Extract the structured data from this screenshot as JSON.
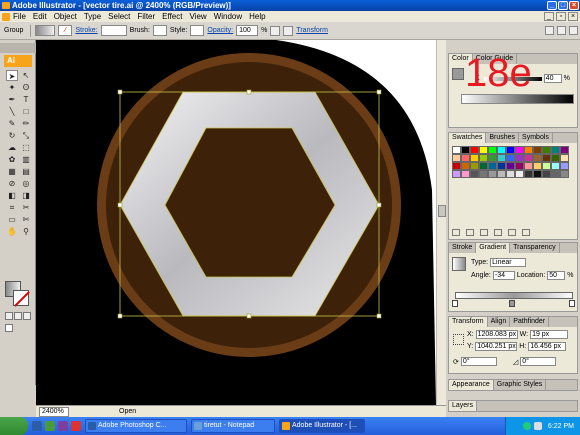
{
  "window": {
    "title": "Adobe Illustrator - [vector tire.ai @ 2400% (RGB/Preview)]"
  },
  "menu": {
    "items": [
      "File",
      "Edit",
      "Object",
      "Type",
      "Select",
      "Filter",
      "Effect",
      "View",
      "Window",
      "Help"
    ]
  },
  "control": {
    "selection_type": "Group",
    "stroke_label": "Stroke:",
    "brush_label": "Brush:",
    "style_label": "Style:",
    "opacity_label": "Opacity:",
    "opacity_value": "100",
    "opacity_unit": "%",
    "transform_label": "Transform"
  },
  "tools": {
    "logo": "Ai"
  },
  "overlay_text": "18e",
  "color_panel": {
    "tabs": [
      "Color",
      "Color Guide"
    ],
    "k_label": "K",
    "k_value": "40",
    "k_unit": "%"
  },
  "swatches_panel": {
    "tabs": [
      "Swatches",
      "Brushes",
      "Symbols"
    ],
    "colors": [
      "#ffffff",
      "#000000",
      "#ff0000",
      "#ffff00",
      "#00ff00",
      "#00ffff",
      "#0000ff",
      "#ff00ff",
      "#ff7f00",
      "#7f3f00",
      "#3f7f00",
      "#007f7f",
      "#7f007f",
      "#ffcc99",
      "#ff6666",
      "#ffcc00",
      "#99cc00",
      "#339933",
      "#33cccc",
      "#3366ff",
      "#9933cc",
      "#cc3399",
      "#996633",
      "#663300",
      "#336600",
      "#ffe0b0",
      "#cc0000",
      "#cc6600",
      "#999900",
      "#006633",
      "#006699",
      "#003399",
      "#660099",
      "#990066",
      "#ff9999",
      "#ffcc66",
      "#ccff99",
      "#99ffff",
      "#9999ff",
      "#cc99ff",
      "#ff99cc",
      "#555555",
      "#777777",
      "#999999",
      "#bbbbbb",
      "#dddddd",
      "#eeeeee",
      "#333333",
      "#111111",
      "#444444",
      "#666666",
      "#888888"
    ]
  },
  "gradient_panel": {
    "tabs": [
      "Stroke",
      "Gradient",
      "Transparency"
    ],
    "type_label": "Type:",
    "type_value": "Linear",
    "angle_label": "Angle:",
    "angle_value": "-34",
    "location_label": "Location:",
    "location_value": "50",
    "location_unit": "%"
  },
  "transform_panel": {
    "tabs": [
      "Transform",
      "Align",
      "Pathfinder"
    ],
    "x_label": "X:",
    "x_value": "1208.083 px",
    "y_label": "Y:",
    "y_value": "1040.251 px",
    "w_label": "W:",
    "w_value": "19 px",
    "h_label": "H:",
    "h_value": "16.456 px",
    "rot_value": "0°",
    "shear_value": "0°"
  },
  "appearance_panel": {
    "tabs": [
      "Appearance",
      "Graphic Styles"
    ]
  },
  "layers_panel": {
    "tabs": [
      "Layers"
    ]
  },
  "statusbar": {
    "zoom": "2400%",
    "status": "Open"
  },
  "taskbar": {
    "tasks": [
      {
        "label": "Adobe Photoshop C...",
        "color": "#2a5caa"
      },
      {
        "label": "tiretut - Notepad",
        "color": "#6aa0d8"
      },
      {
        "label": "Adobe Illustrator - [...",
        "color": "#f7a41b"
      }
    ],
    "time": "6:22 PM"
  }
}
